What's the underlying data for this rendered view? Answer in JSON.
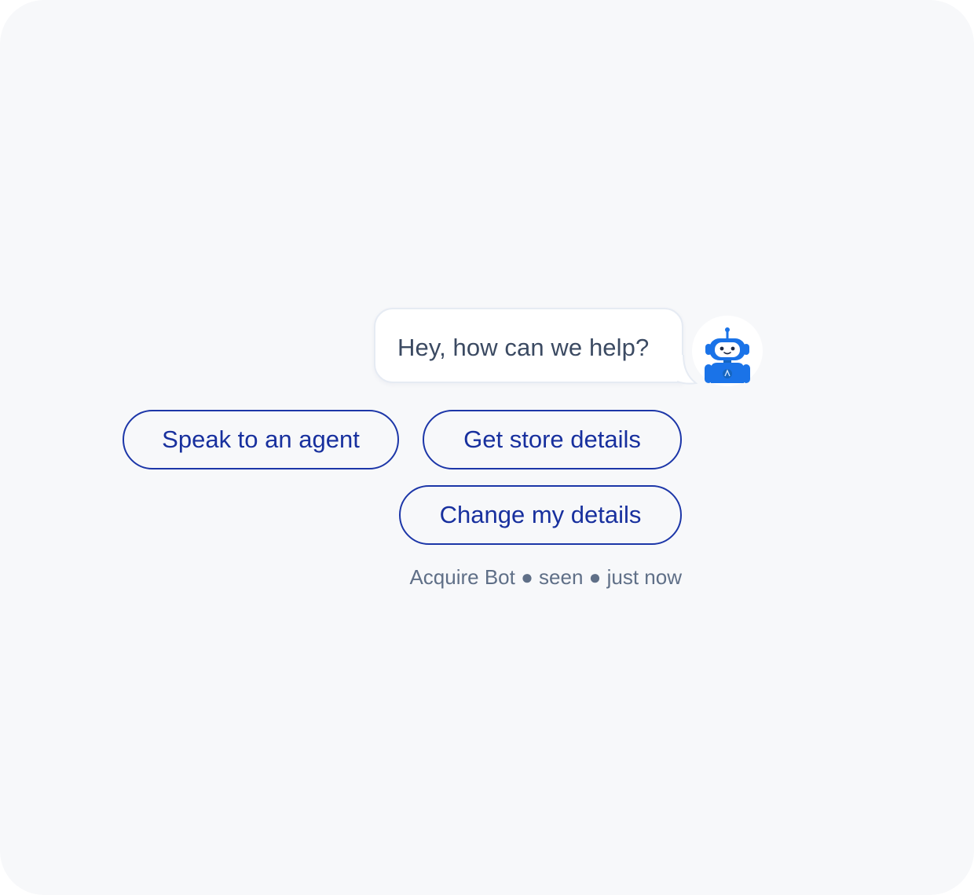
{
  "chat": {
    "bot_message": "Hey, how can we help?",
    "avatar_icon": "robot-icon",
    "quick_replies": [
      {
        "label": "Speak to an agent"
      },
      {
        "label": "Get store details"
      },
      {
        "label": "Change my details"
      }
    ],
    "status": {
      "sender": "Acquire Bot",
      "separator": "●",
      "seen": "seen",
      "time": "just now"
    }
  },
  "colors": {
    "background": "#f7f8fa",
    "accent_text": "#18309e",
    "accent_border": "#1c36a8",
    "bot_blue": "#1a73e8",
    "message_text": "#3b4a62",
    "status_text": "#5f6f87"
  }
}
